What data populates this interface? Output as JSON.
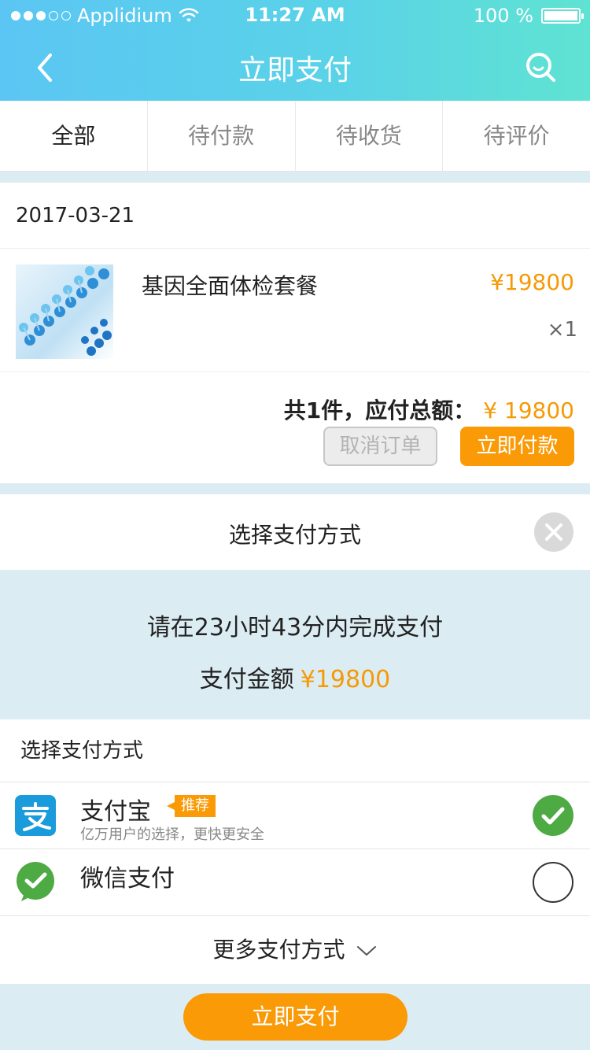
{
  "status_bar": {
    "carrier": "Applidium",
    "time": "11:27 AM",
    "battery": "100 %"
  },
  "header": {
    "title": "立即支付"
  },
  "tabs": [
    {
      "label": "全部"
    },
    {
      "label": "待付款"
    },
    {
      "label": "待收货"
    },
    {
      "label": "待评价"
    }
  ],
  "order": {
    "date": "2017-03-21",
    "item_name": "基因全面体检套餐",
    "item_price": "¥19800",
    "item_qty": "×1",
    "summary_label": "共1件，应付总额：",
    "summary_amount": "¥ 19800",
    "cancel_label": "取消订单",
    "pay_label": "立即付款"
  },
  "payment_sheet": {
    "title": "选择支付方式",
    "countdown_text": "请在23小时43分内完成支付",
    "amount_label": "支付金额",
    "amount_value": "¥19800",
    "methods_label": "选择支付方式",
    "methods": [
      {
        "name": "支付宝",
        "tag": "推荐",
        "desc": "亿万用户的选择，更快更安全",
        "selected": true,
        "icon": "alipay-icon"
      },
      {
        "name": "微信支付",
        "selected": false,
        "icon": "wechat-pay-icon"
      }
    ],
    "more_label": "更多支付方式",
    "pay_button": "立即支付"
  },
  "colors": {
    "accent": "#f99a06",
    "header_start": "#5bc6f3",
    "header_end": "#5fe3d2",
    "alipay": "#1a9bdc",
    "wechat": "#4eaa43"
  }
}
